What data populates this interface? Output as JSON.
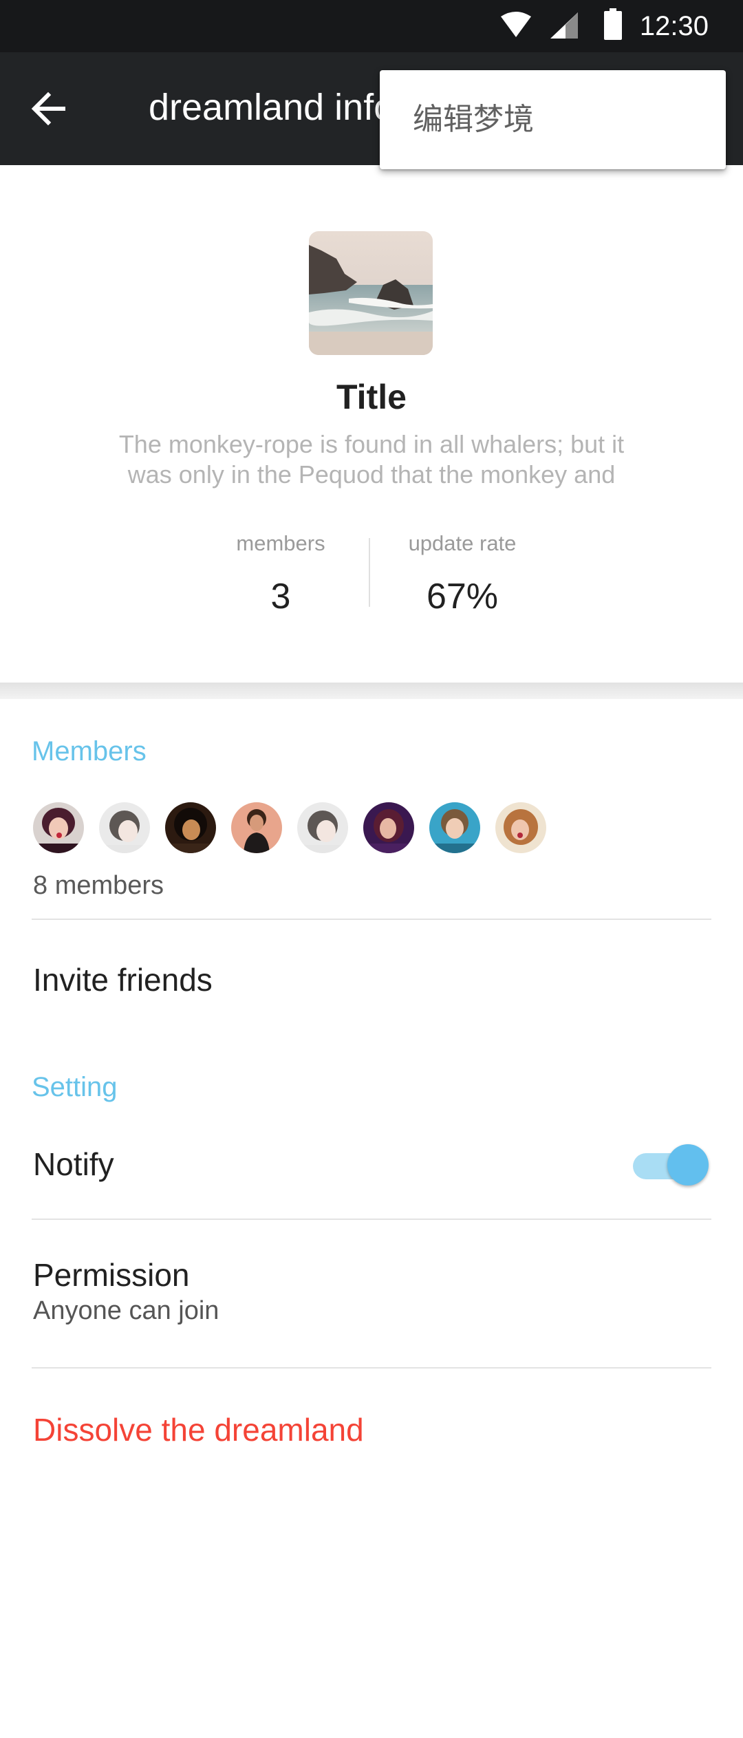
{
  "status_bar": {
    "time": "12:30",
    "icons": [
      "wifi-icon",
      "signal-icon",
      "battery-icon"
    ]
  },
  "app_bar": {
    "back_icon": "arrow-back-icon",
    "title": "dreamland info"
  },
  "popup_menu": {
    "items": [
      {
        "label": "编辑梦境"
      }
    ]
  },
  "header": {
    "title": "Title",
    "description": "The monkey-rope is found in all whalers; but it was only in the Pequod that the monkey and",
    "stats": {
      "members": {
        "label": "members",
        "value": "3"
      },
      "update_rate": {
        "label": "update rate",
        "value": "67%"
      }
    }
  },
  "members_section": {
    "label": "Members",
    "avatar_count": 8,
    "count_text": "8 members",
    "invite": "Invite friends"
  },
  "setting_section": {
    "label": "Setting",
    "notify": {
      "label": "Notify",
      "enabled": true
    },
    "permission": {
      "label": "Permission",
      "value": "Anyone can join"
    },
    "dissolve": "Dissolve the dreamland"
  },
  "colors": {
    "accent": "#67c3ea",
    "danger": "#f44336",
    "app_bar": "#222426",
    "status_bar": "#17181a"
  }
}
